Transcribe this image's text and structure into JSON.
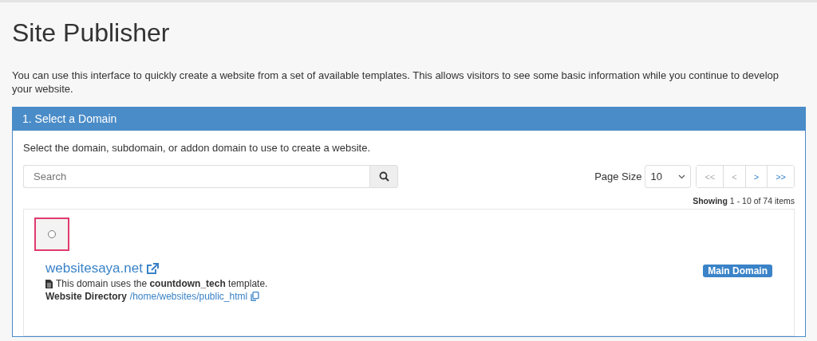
{
  "page": {
    "title": "Site Publisher",
    "description": "You can use this interface to quickly create a website from a set of available templates. This allows visitors to see some basic information while you continue to develop your website."
  },
  "panel": {
    "title": "1. Select a Domain",
    "instructions": "Select the domain, subdomain, or addon domain to use to create a website.",
    "search": {
      "placeholder": "Search"
    },
    "page_size": {
      "label": "Page Size",
      "value": "10"
    },
    "pagination": [
      {
        "label": "<<",
        "disabled": true
      },
      {
        "label": "<",
        "disabled": true
      },
      {
        "label": ">",
        "disabled": false
      },
      {
        "label": ">>",
        "disabled": false
      }
    ],
    "showing": "**Showing** 1 - 10 of 74 items",
    "domains": [
      {
        "selected": false,
        "highlighted": true,
        "name": "websitesaya.net",
        "template_note": "This domain uses the **countdown_tech** template.",
        "directory_label": "Website Directory",
        "directory": "/home/websites/public_html",
        "badge": "Main Domain"
      }
    ]
  }
}
